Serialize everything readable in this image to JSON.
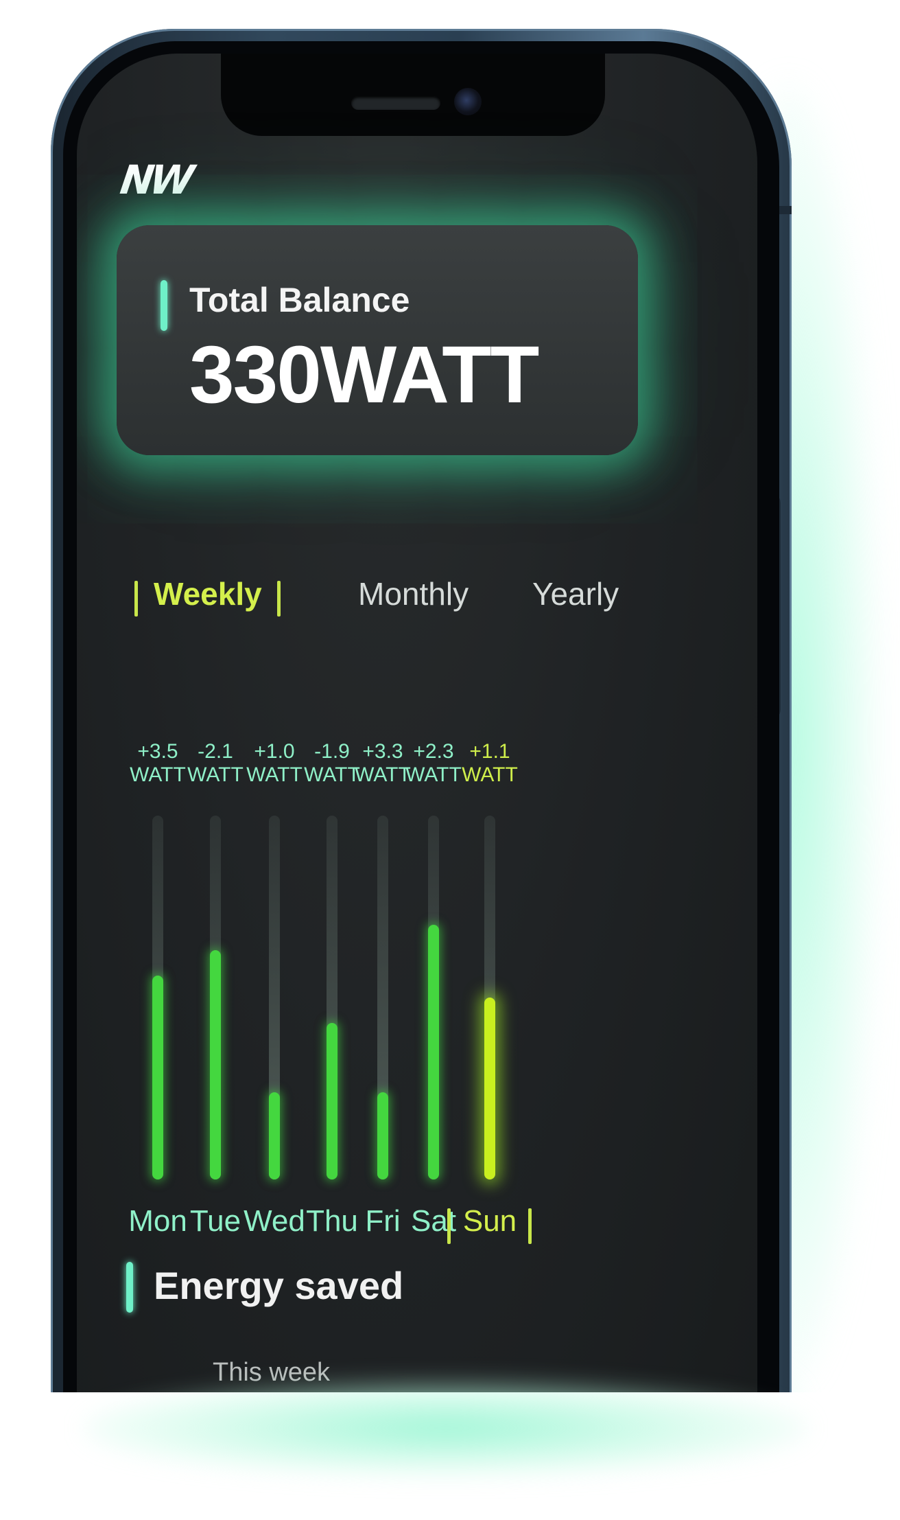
{
  "app": {
    "logo_text": "NW"
  },
  "balance": {
    "label": "Total Balance",
    "value": "330WATT"
  },
  "tabs": [
    {
      "label": "Weekly",
      "active": true
    },
    {
      "label": "Monthly",
      "active": false
    },
    {
      "label": "Yearly",
      "active": false
    }
  ],
  "chart_data": {
    "type": "bar",
    "categories": [
      "Mon",
      "Tue",
      "Wed",
      "Thu",
      "Fri",
      "Sat",
      "Sun"
    ],
    "value_labels": [
      "+3.5\nWATT",
      "-2.1\nWATT",
      "+1.0\nWATT",
      "-1.9\nWATT",
      "+3.3\nWATT",
      "+2.3\nWATT",
      "+1.1\nWATT"
    ],
    "values": [
      3.5,
      -2.1,
      1.0,
      -1.9,
      3.3,
      2.3,
      1.1
    ],
    "levels": [
      0.56,
      0.63,
      0.24,
      0.43,
      0.24,
      0.7,
      0.5
    ],
    "active_index": 6,
    "colors": {
      "bar": "#44d73f",
      "active_bar": "#c9f01f",
      "label": "#8ff0c8",
      "active_label": "#cfee4b"
    }
  },
  "energy": {
    "title": "Energy saved",
    "subtitle": "This week"
  }
}
